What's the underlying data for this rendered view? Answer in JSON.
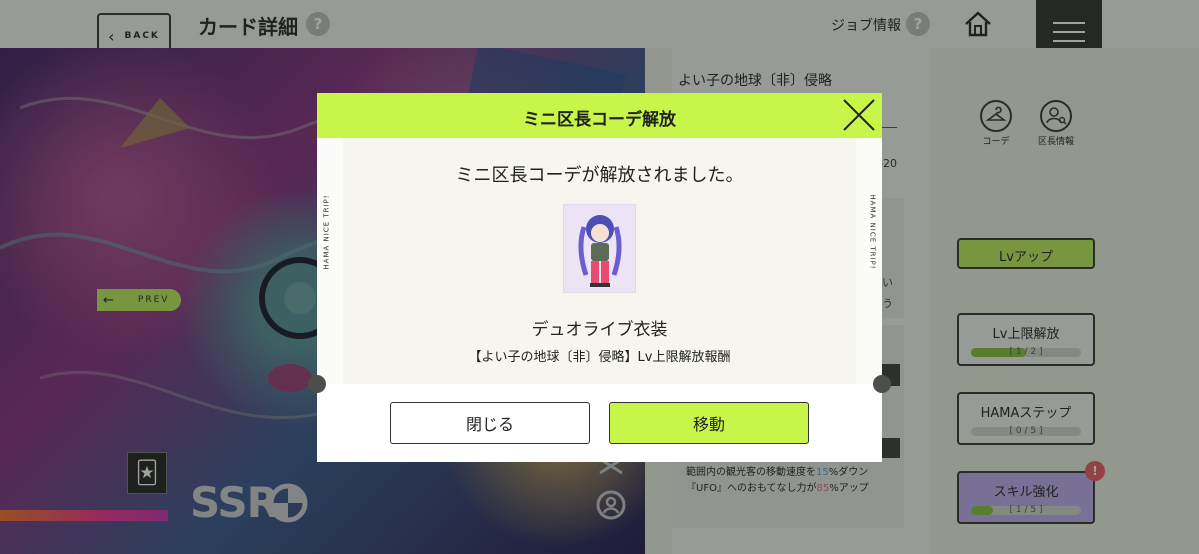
{
  "header": {
    "back_label": "BACK",
    "title": "カード詳細",
    "help_glyph": "?",
    "job_info_label": "ジョブ情報"
  },
  "card": {
    "prev_label": "PREV",
    "rarity": "SSR",
    "name": "よい子の地球〔非〕侵略",
    "lv_fragment": "620",
    "text_fragment_1": "い",
    "text_fragment_2": "う",
    "skill_desc_1_a": "範囲内の観光客の移動速度を",
    "skill_desc_1_num": "15",
    "skill_desc_1_b": "%ダウン",
    "skill_desc_2_a": "『UFO』へのおもてなし力が",
    "skill_desc_2_num": "85",
    "skill_desc_2_b": "%アップ"
  },
  "side_icons": {
    "coordinate_label": "コーデ",
    "district_info_label": "区長情報"
  },
  "actions": {
    "lv_up": "Lvアップ",
    "lv_limit": {
      "label": "Lv上限解放",
      "progress_text": "[ 1 / 2 ]",
      "progress": 0.5
    },
    "hama_step": {
      "label": "HAMAステップ",
      "progress_text": "[ 0 / 5 ]",
      "progress": 0.0
    },
    "skill_up": {
      "label": "スキル強化",
      "progress_text": "[ 1 / 5 ]",
      "progress": 0.2,
      "badge": "!"
    }
  },
  "modal": {
    "title": "ミニ区長コーデ解放",
    "message": "ミニ区長コーデが解放されました。",
    "item_name": "デュオライブ衣装",
    "item_source": "【よい子の地球〔非〕侵略】Lv上限解放報酬",
    "side_text": "HAMA NICE TRIP!",
    "close_label": "閉じる",
    "move_label": "移動"
  },
  "colors": {
    "accent_green": "#c8f54a",
    "button_green": "#b9e858",
    "skill_purple": "#b9a8ea",
    "alert_red": "#e25a5a"
  },
  "icons": [
    "back-chevron-icon",
    "help-icon",
    "home-icon",
    "menu-icon",
    "close-icon",
    "arrow-left-icon",
    "jester-icon",
    "rarity-emblem-icon",
    "hanger-icon",
    "person-search-icon",
    "rotate-icon"
  ]
}
